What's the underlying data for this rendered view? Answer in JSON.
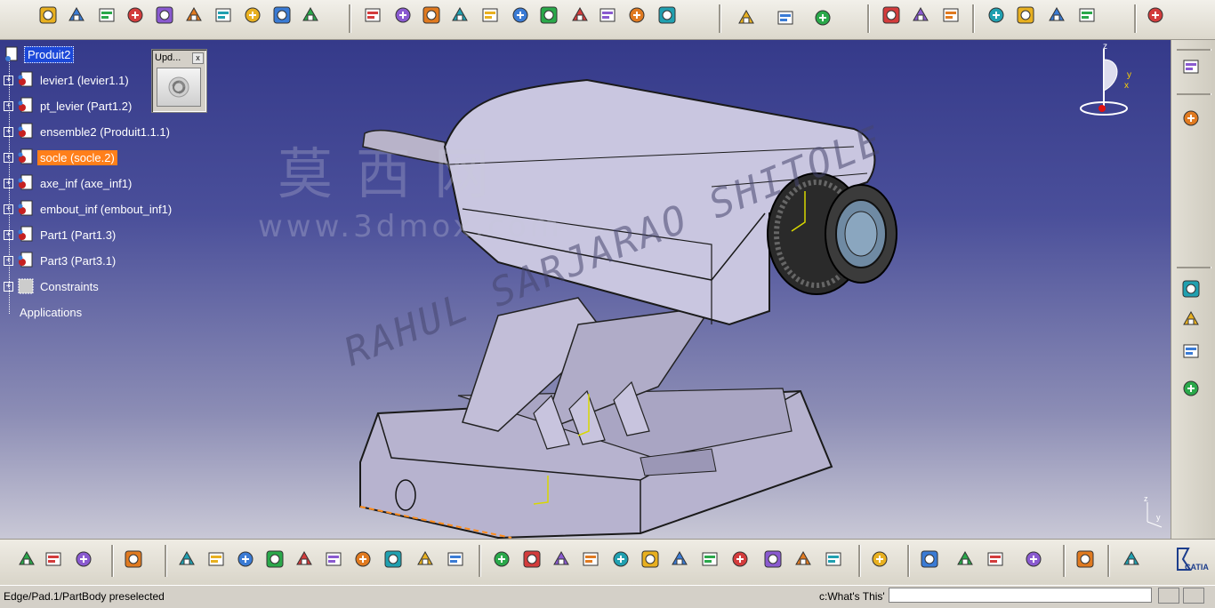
{
  "tree": {
    "root": "Produit2",
    "items": [
      {
        "label": "levier1 (levier1.1)"
      },
      {
        "label": "pt_levier (Part1.2)"
      },
      {
        "label": "ensemble2 (Produit1.1.1)"
      },
      {
        "label": "socle (socle.2)"
      },
      {
        "label": "axe_inf (axe_inf1)"
      },
      {
        "label": "embout_inf (embout_inf1)"
      },
      {
        "label": "Part1 (Part1.3)"
      },
      {
        "label": "Part3 (Part3.1)"
      },
      {
        "label": "Constraints"
      }
    ],
    "applications": "Applications"
  },
  "update_window": {
    "title": "Upd...",
    "close": "x"
  },
  "watermark": {
    "cn": "莫西网",
    "url": "www.3dmox.com",
    "author": "RAHUL SARJARAO SHITOLE"
  },
  "compass_labels": {
    "z": "z",
    "y": "y",
    "x": "x"
  },
  "mini_axes": {
    "z": "z",
    "y": "y"
  },
  "brand": "CATIA",
  "status": {
    "message": "Edge/Pad.1/PartBody preselected",
    "whats_this": "c:What's This'",
    "command_value": ""
  },
  "colors": {
    "selection": "#1c48d8",
    "highlight": "#ff7f1a",
    "viewport_top": "#353a8a",
    "viewport_bottom": "#c9c8d6"
  },
  "icons": {
    "top_toolbar": [
      "product-icon",
      "part-icon",
      "wrench-icon",
      "assembly-icon",
      "anchor-icon",
      "pencil-icon",
      "table-icon",
      "flow-icon",
      "refresh-icon",
      "grid-icon",
      "constraint-icon",
      "constraint2-icon",
      "constraint3-icon",
      "move-icon",
      "snap-icon",
      "explode-icon",
      "clash-icon",
      "copy-icon",
      "analyze-icon",
      "measure-icon",
      "pin-icon",
      "catalog-icon",
      "catalog-arrow-icon",
      "catalog-cube-icon",
      "publish-icon",
      "publish2-icon",
      "publish3-icon",
      "tools-icon",
      "gear-tools-icon",
      "axis-icon",
      "light-icon",
      "cube-view-icon"
    ],
    "bottom_toolbar": [
      "sphere-icon",
      "globe-icon",
      "dots-icon",
      "snap-grid-icon",
      "new-icon",
      "open-icon",
      "save-icon",
      "print-icon",
      "cut-icon",
      "copy-icon",
      "paste-icon",
      "undo-icon",
      "redo-icon",
      "help-arrow-icon",
      "fly-icon",
      "fit-all-icon",
      "pan-icon",
      "rotate-icon",
      "zoom-in-icon",
      "zoom-out-icon",
      "normal-view-icon",
      "multi-view-icon",
      "iso-view-icon",
      "shading-icon",
      "hide-show-icon",
      "swap-icon",
      "doc-icon",
      "measure-icon",
      "double-arrow-icon",
      "tools2-icon",
      "tools3-icon",
      "book-icon",
      "camera-icon",
      "catia-logo-icon"
    ],
    "right_toolbar": [
      "gear-right-icon",
      "select-arrow-icon",
      "box-icon",
      "cubes-icon",
      "tree-icon",
      "tree2-icon"
    ]
  }
}
